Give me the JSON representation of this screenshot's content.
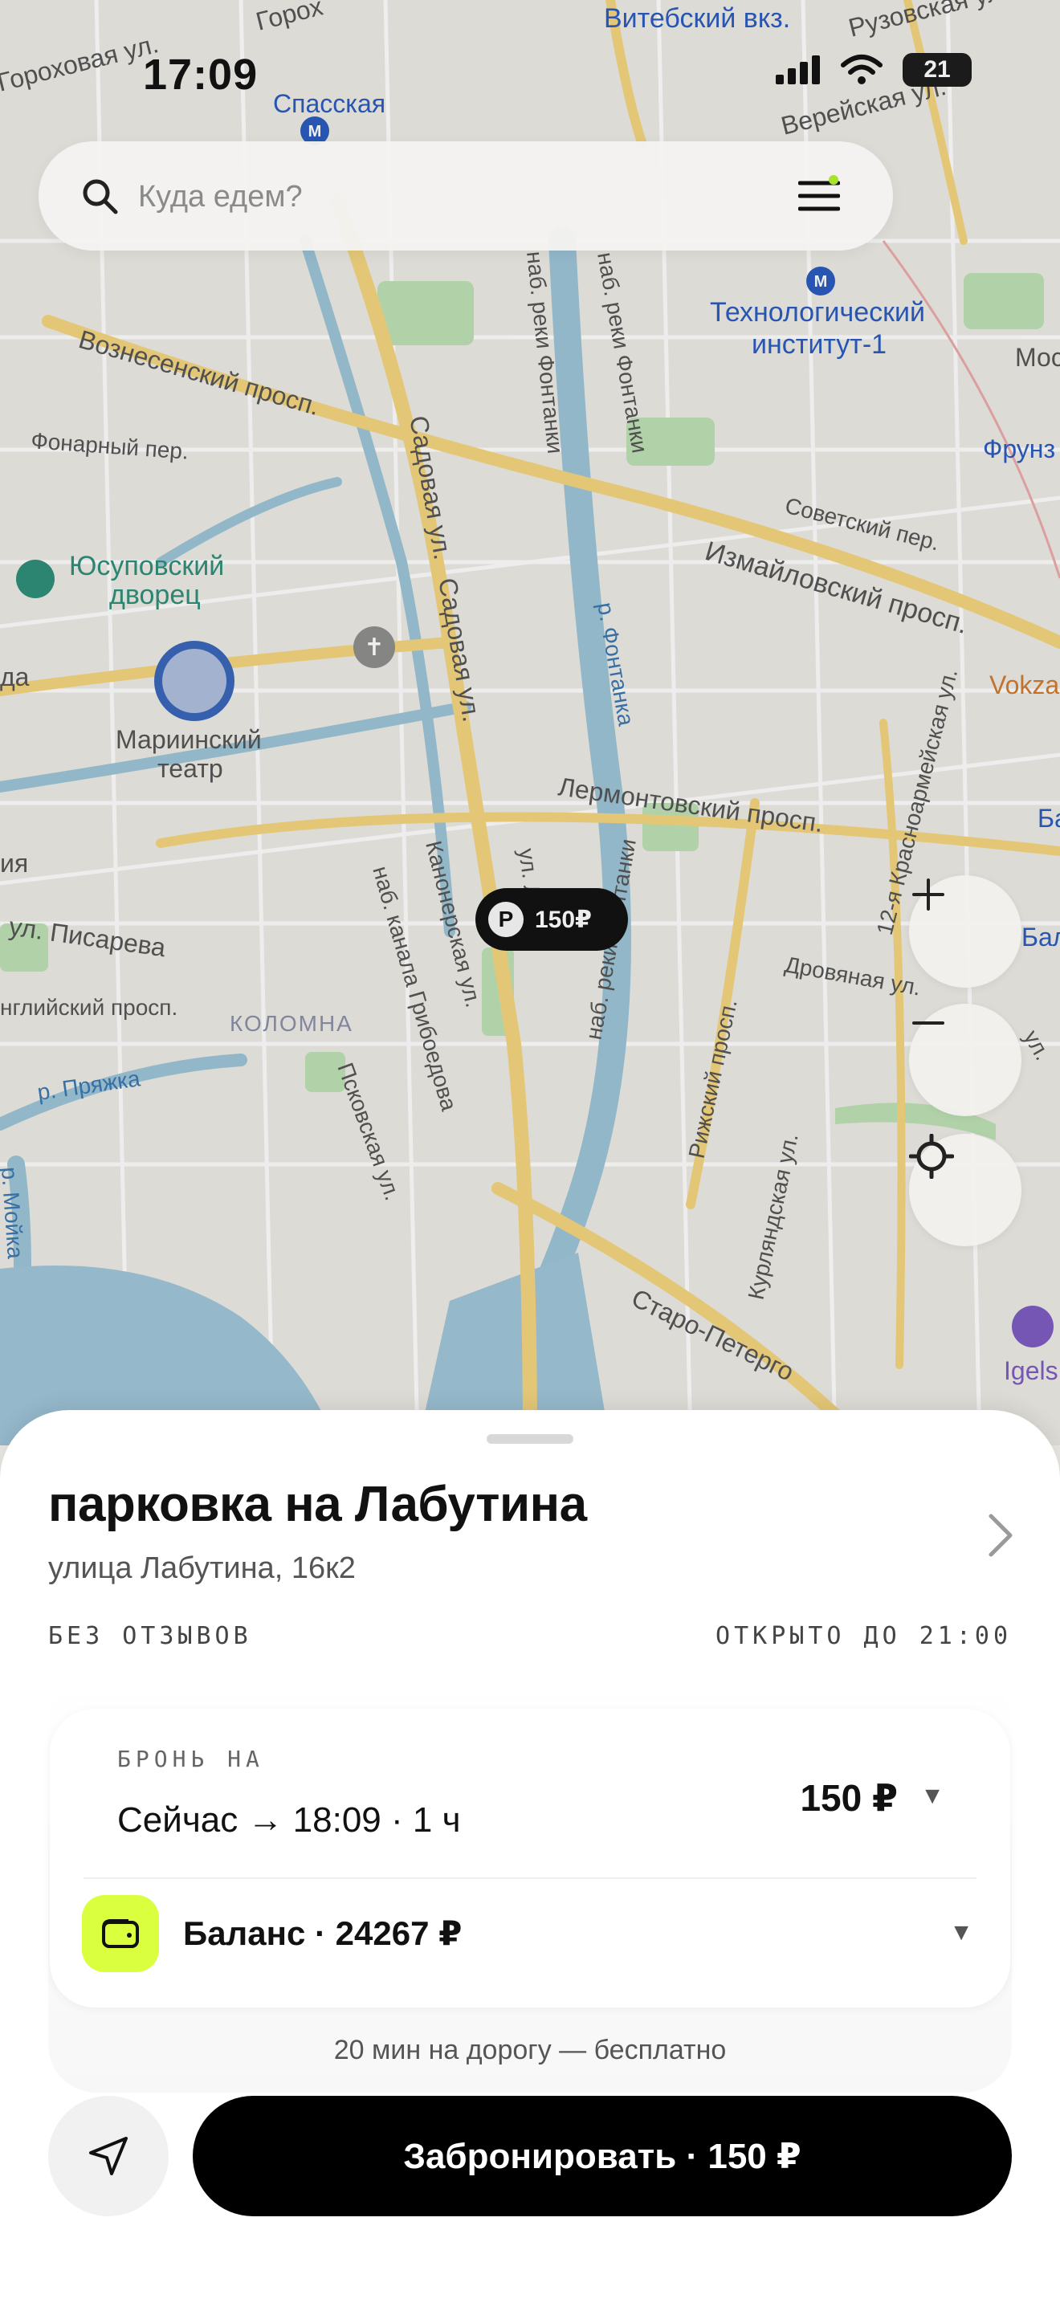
{
  "status_bar": {
    "time": "17:09",
    "battery": "21"
  },
  "search": {
    "placeholder": "Куда едем?"
  },
  "map": {
    "labels": {
      "spasskaya": "Спасская",
      "vitebsky": "Витебский вкз.",
      "ruzovskaya": "Рузовская ул.",
      "vereyskaya": "Верейская ул.",
      "gorokhovaya": "Гороховая ул.",
      "gorokhovaya2": "Горох",
      "tech_inst": "Технологический",
      "tech_inst2": "институт-1",
      "mos": "Мос",
      "frunz": "Фрунз",
      "voznesensky": "Вознесенский просп.",
      "fonarny": "Фонарный пер.",
      "sadovaya1": "Садовая ул.",
      "sadovaya2": "Садовая ул.",
      "fontanki1": "наб. реки Фонтанки",
      "fontanki2": "наб. реки Фонтанки",
      "fontanki3": "наб. реки Фонтанки",
      "fontanka": "р. Фонтанка",
      "sovetsky": "Советский пер.",
      "izmaylovsky": "Измайловский просп.",
      "yusupov1": "Юсуповский",
      "yusupov2": "дворец",
      "mariinsky1": "Мариинский",
      "mariinsky2": "театр",
      "da": "да",
      "vokza": "Vokza",
      "lermontovsky": "Лермонтовский просп.",
      "krasnoarm": "12-я Красноармейская ул.",
      "b1": "Ба",
      "b2": "Бал",
      "kanonerskaya": "Канонерская ул.",
      "ul_l": "ул. Л",
      "griboedova": "наб. канала Грибоедова",
      "pisareva": "ул. Писарева",
      "ya": "ия",
      "angliysky": "нглийский просп.",
      "kolomna": "КОЛОМНА",
      "rizhsky": "Рижский просп.",
      "drovyanaya": "Дровяная ул.",
      "pryazhka": "р. Пряжка",
      "pskovskaya": "Псковская ул.",
      "moyka": "р. Мойка",
      "kurlyandskaya": "Курляндская ул.",
      "staro": "Старо-Петерго",
      "igels": "Igels",
      "ul_right": "ул."
    }
  },
  "parking_pin": {
    "letter": "P",
    "price": "150₽"
  },
  "sheet": {
    "title": "парковка на Лабутина",
    "address": "улица Лабутина, 16к2",
    "reviews": "БЕЗ ОТЗЫВОВ",
    "hours": "ОТКРЫТО ДО 21:00",
    "booking_label": "БРОНЬ НА",
    "booking_time": "Сейчас → 18:09 · 1 ч",
    "booking_price": "150 ₽",
    "balance": "Баланс · 24267 ₽",
    "free_note": "20 мин на дорогу — бесплатно",
    "book_button": "Забронировать · 150 ₽"
  },
  "colors": {
    "accent": "#d9ff3f",
    "button": "#000000",
    "water": "#9cc3d6",
    "park": "#b9dfb0",
    "road": "#f2d37e"
  }
}
